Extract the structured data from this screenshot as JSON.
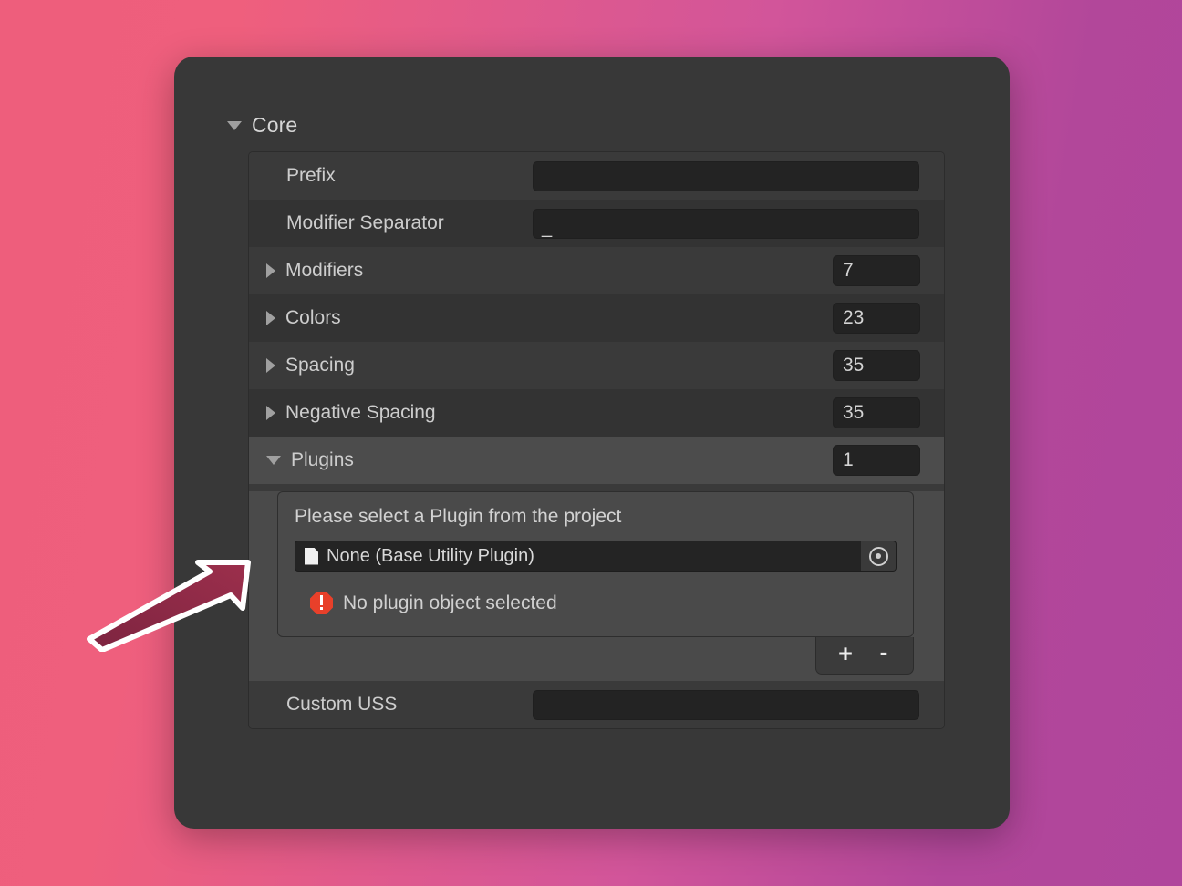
{
  "background": {
    "gradient_from": "#ef5f7d",
    "gradient_to": "#b2479a"
  },
  "inspector": {
    "panel_color": "#383838",
    "section": {
      "title": "Core",
      "expanded": true,
      "foldout_icon": "triangle-down-icon"
    },
    "rows": [
      {
        "id": "prefix",
        "label": "Prefix",
        "type": "text",
        "value": "",
        "placeholder": ""
      },
      {
        "id": "modifier-separator",
        "label": "Modifier Separator",
        "type": "text",
        "value": "_",
        "placeholder": ""
      },
      {
        "id": "modifiers",
        "label": "Modifiers",
        "type": "foldout-array",
        "expanded": false,
        "foldout_icon": "triangle-right-icon",
        "count": "7"
      },
      {
        "id": "colors",
        "label": "Colors",
        "type": "foldout-array",
        "expanded": false,
        "foldout_icon": "triangle-right-icon",
        "count": "23"
      },
      {
        "id": "spacing",
        "label": "Spacing",
        "type": "foldout-array",
        "expanded": false,
        "foldout_icon": "triangle-right-icon",
        "count": "35"
      },
      {
        "id": "negative-spacing",
        "label": "Negative Spacing",
        "type": "foldout-array",
        "expanded": false,
        "foldout_icon": "triangle-right-icon",
        "count": "35"
      },
      {
        "id": "plugins",
        "label": "Plugins",
        "type": "foldout-array",
        "expanded": true,
        "foldout_icon": "triangle-down-icon",
        "count": "1"
      }
    ],
    "plugins_panel": {
      "hint": "Please select a Plugin from the project",
      "object_field": {
        "icon": "document-icon",
        "value": "None (Base Utility Plugin)",
        "picker_icon": "object-picker-icon"
      },
      "error": {
        "icon": "error-octagon-icon",
        "icon_color": "#e8402a",
        "message": "No plugin object selected"
      },
      "add_label": "+",
      "remove_label": "-"
    },
    "custom_uss": {
      "label": "Custom USS",
      "value": "",
      "placeholder": ""
    }
  },
  "annotation": {
    "arrow": {
      "fill": "#8e2a45",
      "outline": "#ffffff",
      "points_to": "plugins-object-field"
    }
  }
}
